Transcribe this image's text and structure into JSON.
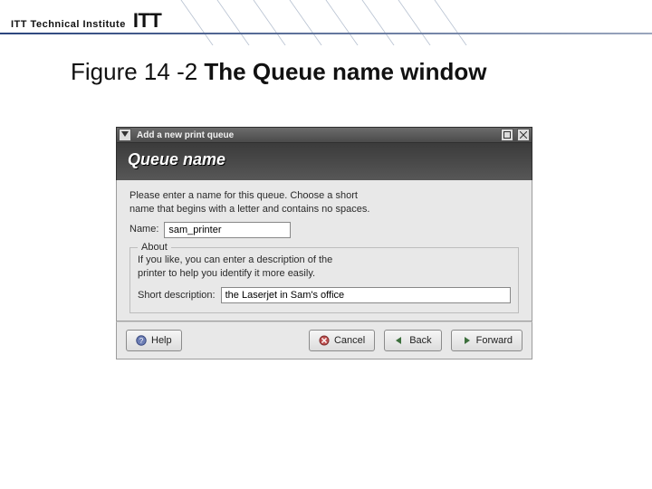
{
  "brand": {
    "small": "ITT Technical Institute",
    "big": "ITT"
  },
  "caption": {
    "prefix": "Figure 14 -2 ",
    "bold": "The Queue name window"
  },
  "window": {
    "title": "Add a new print queue",
    "header": "Queue name",
    "instruction_line1": "Please enter a name for this queue. Choose a short",
    "instruction_line2": "name that begins with a letter and contains no spaces.",
    "name_label": "Name:",
    "name_value": "sam_printer",
    "about_legend": "About",
    "about_line1": "If you like, you can enter a description of the",
    "about_line2": "printer to help you identify it more easily.",
    "desc_label": "Short description:",
    "desc_value": "the Laserjet in Sam's office",
    "buttons": {
      "help": "Help",
      "cancel": "Cancel",
      "back": "Back",
      "forward": "Forward"
    }
  }
}
